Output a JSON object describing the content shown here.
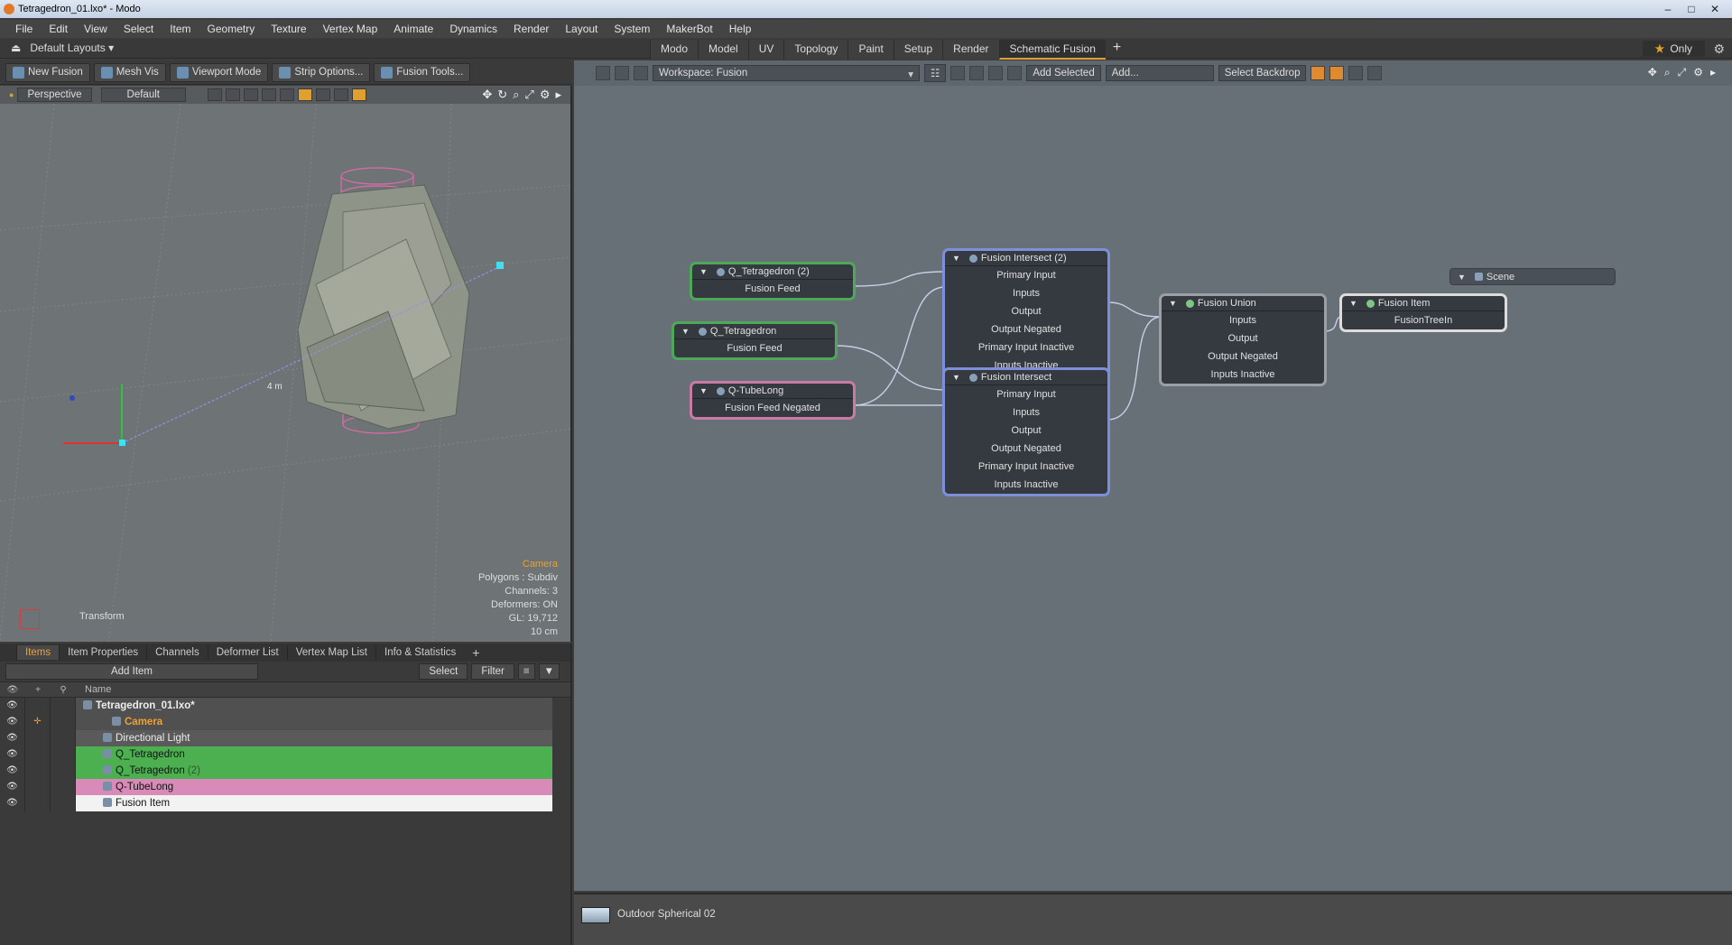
{
  "window": {
    "title": "Tetragedron_01.lxo* - Modo"
  },
  "menu": [
    "File",
    "Edit",
    "View",
    "Select",
    "Item",
    "Geometry",
    "Texture",
    "Vertex Map",
    "Animate",
    "Dynamics",
    "Render",
    "Layout",
    "System",
    "MakerBot",
    "Help"
  ],
  "layout": {
    "selector": "Default Layouts",
    "tabs": [
      "Modo",
      "Model",
      "UV",
      "Topology",
      "Paint",
      "Setup",
      "Render",
      "Schematic Fusion"
    ],
    "active_tab": "Schematic Fusion",
    "only_label": "Only"
  },
  "toolbar": {
    "new_fusion": "New Fusion",
    "mesh_vis": "Mesh Vis",
    "viewport_mode": "Viewport Mode",
    "strip_options": "Strip Options...",
    "fusion_tools": "Fusion Tools..."
  },
  "viewport": {
    "view": "Perspective",
    "shading": "Default",
    "distance_label": "4 m",
    "info": {
      "camera": "Camera",
      "polygons": "Polygons : Subdiv",
      "channels": "Channels: 3",
      "deformers": "Deformers: ON",
      "gl": "GL: 19,712",
      "scale": "10 cm"
    },
    "transform_label": "Transform"
  },
  "items_panel": {
    "tabs": [
      "Items",
      "Item Properties",
      "Channels",
      "Deformer List",
      "Vertex Map List",
      "Info & Statistics"
    ],
    "active_tab": "Items",
    "add_item": "Add Item",
    "select": "Select",
    "filter": "Filter",
    "name_header": "Name",
    "rows": [
      {
        "name": "Tetragedron_01.lxo*",
        "kind": "root"
      },
      {
        "name": "Camera",
        "kind": "camera"
      },
      {
        "name": "Directional Light",
        "kind": "light"
      },
      {
        "name": "Q_Tetragedron",
        "kind": "green"
      },
      {
        "name": "Q_Tetragedron",
        "count": "(2)",
        "kind": "green"
      },
      {
        "name": "Q-TubeLong",
        "kind": "pink"
      },
      {
        "name": "Fusion Item",
        "kind": "white"
      }
    ]
  },
  "schematic": {
    "workspace": "Workspace: Fusion",
    "add_selected": "Add Selected",
    "add": "Add...",
    "select_backdrop": "Select Backdrop",
    "nodes": {
      "qtet2": {
        "title": "Q_Tetragedron (2)",
        "ports": [
          "Fusion Feed"
        ]
      },
      "qtet": {
        "title": "Q_Tetragedron",
        "ports": [
          "Fusion Feed"
        ]
      },
      "qtube": {
        "title": "Q-TubeLong",
        "ports": [
          "Fusion Feed Negated"
        ]
      },
      "intersect2": {
        "title": "Fusion Intersect (2)",
        "ports": [
          "Primary Input",
          "Inputs",
          "Output",
          "Output Negated",
          "Primary Input Inactive",
          "Inputs Inactive"
        ]
      },
      "intersect": {
        "title": "Fusion Intersect",
        "ports": [
          "Primary Input",
          "Inputs",
          "Output",
          "Output Negated",
          "Primary Input Inactive",
          "Inputs Inactive"
        ]
      },
      "union": {
        "title": "Fusion Union",
        "ports": [
          "Inputs",
          "Output",
          "Output Negated",
          "Inputs Inactive"
        ]
      },
      "fitem": {
        "title": "Fusion Item",
        "ports": [
          "FusionTreeIn"
        ]
      },
      "scene": {
        "title": "Scene",
        "ports": []
      }
    }
  },
  "status": {
    "environment": "Outdoor Spherical 02"
  }
}
